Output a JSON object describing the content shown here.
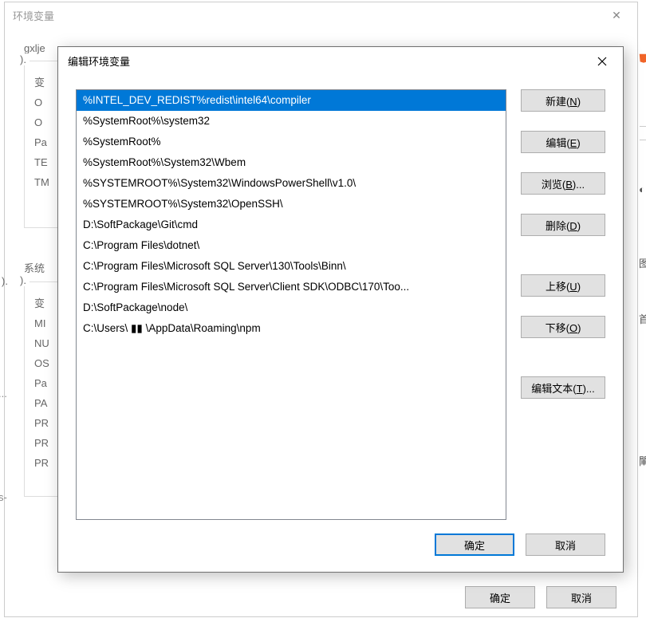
{
  "parent_dialog": {
    "title": "环境变量",
    "user_label_partial": "gxlje",
    "user_group_label_partial": ").",
    "user_rows": [
      "变",
      "O",
      "O",
      "Pa",
      "TE",
      "TM"
    ],
    "system_label_partial": "系统",
    "system_group_label_partial": ").",
    "sys_rows": [
      "变",
      "MI",
      "NU",
      "OS",
      "Pa",
      "PA",
      "PR",
      "PR",
      "PR"
    ],
    "ok": "确定",
    "cancel": "取消",
    "left_frag_1": ").",
    "left_frag_2": "...",
    "left_frag_3": "s-"
  },
  "right_fragments": {
    "a": "图",
    "b": "首",
    "c": "閳"
  },
  "edit_dialog": {
    "title": "编辑环境变量",
    "list": [
      "%INTEL_DEV_REDIST%redist\\intel64\\compiler",
      "%SystemRoot%\\system32",
      "%SystemRoot%",
      "%SystemRoot%\\System32\\Wbem",
      "%SYSTEMROOT%\\System32\\WindowsPowerShell\\v1.0\\",
      "%SYSTEMROOT%\\System32\\OpenSSH\\",
      "D:\\SoftPackage\\Git\\cmd",
      "C:\\Program Files\\dotnet\\",
      "C:\\Program Files\\Microsoft SQL Server\\130\\Tools\\Binn\\",
      "C:\\Program Files\\Microsoft SQL Server\\Client SDK\\ODBC\\170\\Too...",
      "D:\\SoftPackage\\node\\",
      "C:\\Users\\ ▮▮ \\AppData\\Roaming\\npm"
    ],
    "selected_index": 0,
    "buttons": {
      "new_pre": "新建(",
      "new_m": "N",
      "new_post": ")",
      "edit_pre": "编辑(",
      "edit_m": "E",
      "edit_post": ")",
      "browse_pre": "浏览(",
      "browse_m": "B",
      "browse_post": ")...",
      "delete_pre": "删除(",
      "delete_m": "D",
      "delete_post": ")",
      "up_pre": "上移(",
      "up_m": "U",
      "up_post": ")",
      "down_pre": "下移(",
      "down_m": "O",
      "down_post": ")",
      "edittext_pre": "编辑文本(",
      "edittext_m": "T",
      "edittext_post": ")..."
    },
    "ok": "确定",
    "cancel": "取消"
  }
}
